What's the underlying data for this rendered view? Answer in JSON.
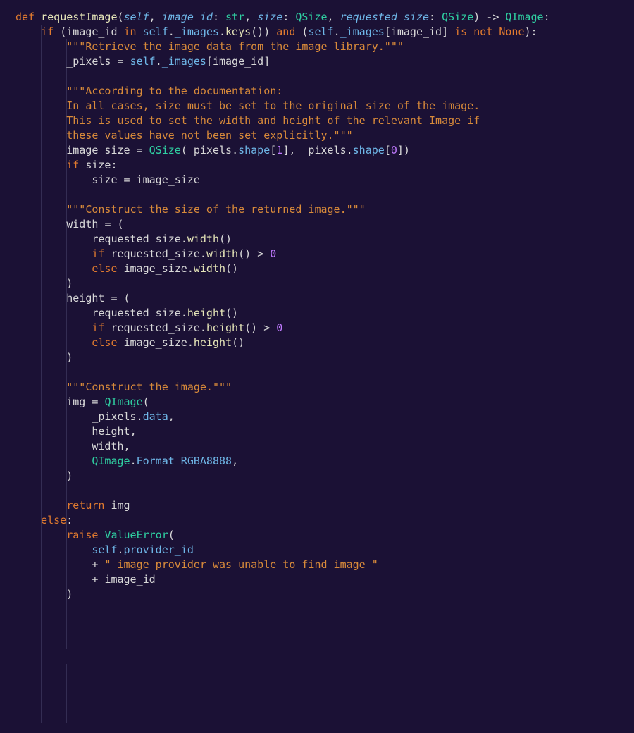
{
  "colors": {
    "background": "#1b1135",
    "keyword": "#e07a2f",
    "function": "#e5e5b8",
    "param": "#6fb7e8",
    "type": "#2fd0a2",
    "docstring": "#d88a3a",
    "number": "#c07aff"
  },
  "code": {
    "l1": {
      "def": "def",
      "fn": "requestImage",
      "p_self": "self",
      "p1": "image_id",
      "t1": "str",
      "p2": "size",
      "t2": "QSize",
      "p3": "requested_size",
      "t3": "QSize",
      "ret": "QImage"
    },
    "l2": {
      "if": "if",
      "a": "image_id",
      "in": "in",
      "self": "self",
      "images": "_images",
      "keys": "keys",
      "and": "and",
      "isnot": "is not",
      "none": "None"
    },
    "doc1": "\"\"\"Retrieve the image data from the image library.\"\"\"",
    "l4": {
      "var": "_pixels",
      "self": "self",
      "images": "_images",
      "key": "image_id"
    },
    "doc2a": "\"\"\"According to the documentation:",
    "doc2b": "In all cases, size must be set to the original size of the image.",
    "doc2c": "This is used to set the width and height of the relevant Image if",
    "doc2d": "these values have not been set explicitly.\"\"\"",
    "l10": {
      "var": "image_size",
      "ctor": "QSize",
      "px": "_pixels",
      "shape": "shape",
      "i1": "1",
      "i0": "0"
    },
    "l11": {
      "if": "if",
      "cond": "size"
    },
    "l12": {
      "lhs": "size",
      "rhs": "image_size"
    },
    "doc3": "\"\"\"Construct the size of the returned image.\"\"\"",
    "l14": {
      "var": "width"
    },
    "l15": {
      "obj": "requested_size",
      "m": "width"
    },
    "l16": {
      "if": "if",
      "obj": "requested_size",
      "m": "width",
      "cmp": ">",
      "n": "0"
    },
    "l17": {
      "else": "else",
      "obj": "image_size",
      "m": "width"
    },
    "l19": {
      "var": "height"
    },
    "l20": {
      "obj": "requested_size",
      "m": "height"
    },
    "l21": {
      "if": "if",
      "obj": "requested_size",
      "m": "height",
      "cmp": ">",
      "n": "0"
    },
    "l22": {
      "else": "else",
      "obj": "image_size",
      "m": "height"
    },
    "doc4": "\"\"\"Construct the image.\"\"\"",
    "l25": {
      "var": "img",
      "ctor": "QImage"
    },
    "l26": {
      "obj": "_pixels",
      "prop": "data"
    },
    "l27": {
      "a": "height"
    },
    "l28": {
      "a": "width"
    },
    "l29": {
      "cls": "QImage",
      "prop": "Format_RGBA8888"
    },
    "l31": {
      "ret": "return",
      "v": "img"
    },
    "l32": {
      "else": "else"
    },
    "l33": {
      "raise": "raise",
      "exc": "ValueError"
    },
    "l34": {
      "self": "self",
      "prop": "provider_id"
    },
    "l35": {
      "op": "+",
      "s": "\" image provider was unable to find image \""
    },
    "l36": {
      "op": "+",
      "v": "image_id"
    }
  }
}
